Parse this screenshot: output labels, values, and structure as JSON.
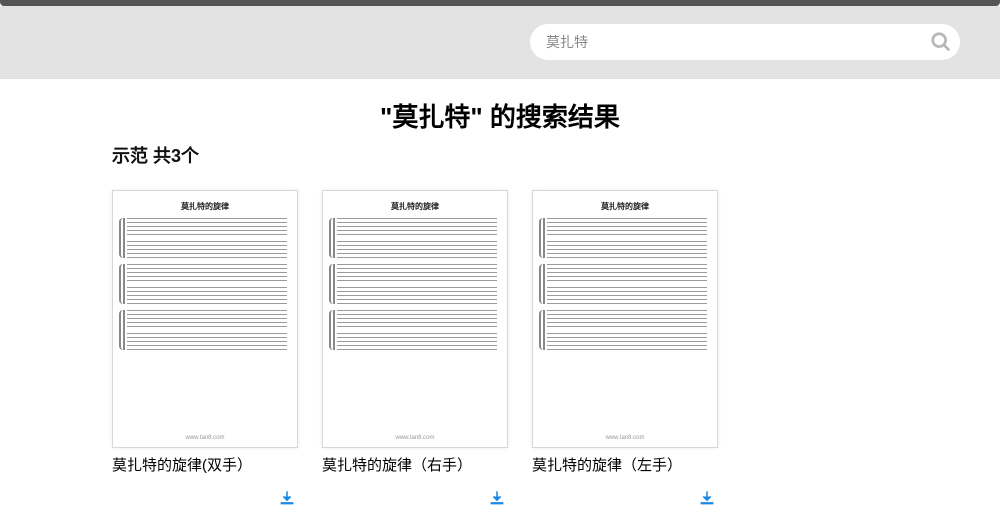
{
  "search": {
    "value": "莫扎特"
  },
  "results_header": "\"莫扎特\" 的搜索结果",
  "section_label": "示范 共3个",
  "thumb_title": "莫扎特的旋律",
  "thumb_footer": "www.tan8.com",
  "cards": [
    {
      "title": "莫扎特的旋律(双手）"
    },
    {
      "title": "莫扎特的旋律（右手）"
    },
    {
      "title": "莫扎特的旋律（左手）"
    }
  ]
}
